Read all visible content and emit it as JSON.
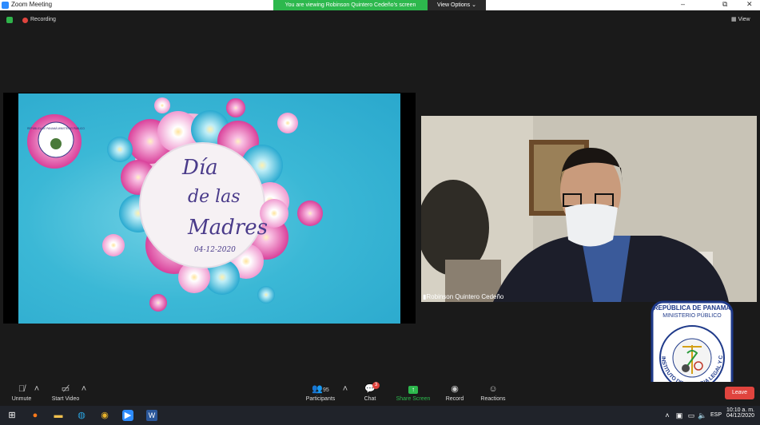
{
  "window": {
    "title": "Zoom Meeting",
    "minimize": "–",
    "maximize": "⧉",
    "close": "✕"
  },
  "banner": {
    "text": "You are viewing Robinson Quintero Cedeño's screen",
    "view_options": "View Options ⌄"
  },
  "status": {
    "recording": "Recording",
    "view": "View"
  },
  "slide": {
    "title_line1": "Día",
    "title_line2": "de las",
    "title_line3": "Madres",
    "date": "04-12-2020",
    "logo_text": "REPÚBLICA DE PANAMÁ MINISTERIO PÚBLICO"
  },
  "video": {
    "participant_name": "Robinson Quintero Cedeño"
  },
  "badge": {
    "line1": "REPÚBLICA DE PANAMÁ",
    "line2": "MINISTERIO PÚBLICO",
    "arc_text": "INSTITUTO DE MEDICINA LEGAL Y CIENCIAS FORENSES"
  },
  "toolbar": {
    "unmute": "Unmute",
    "start_video": "Start Video",
    "participants": "Participants",
    "participants_count": "95",
    "chat": "Chat",
    "chat_badge": "3",
    "share_screen": "Share Screen",
    "record": "Record",
    "reactions": "Reactions",
    "leave": "Leave"
  },
  "taskbar": {
    "time": "10:10 a. m.",
    "date": "04/12/2020",
    "language": "ESP"
  },
  "colors": {
    "accent_green": "#2db84d",
    "leave_red": "#e0443e",
    "zoom_blue": "#2d8cff"
  }
}
